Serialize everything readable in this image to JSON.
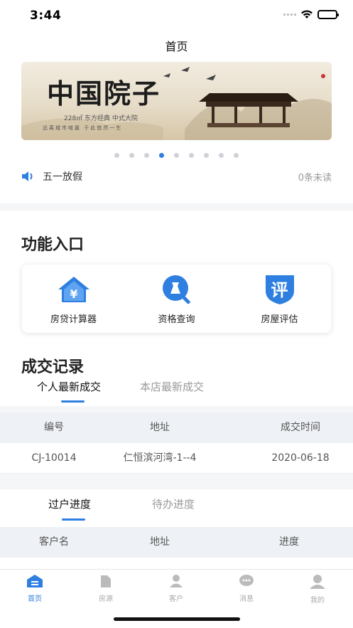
{
  "status_bar": {
    "time": "3:44"
  },
  "nav": {
    "title": "首页"
  },
  "banner": {
    "calligraphy": "中国院子",
    "subtitle": "228㎡ 东方经典 中式大院",
    "tagline": "远离城市喧嚣    于此悠然一生"
  },
  "carousel": {
    "count": 9,
    "active_index": 3
  },
  "notice": {
    "text": "五一放假",
    "unread": "0条未读"
  },
  "functions": {
    "title": "功能入口",
    "items": [
      {
        "label": "房贷计算器",
        "icon": "house-yen-icon"
      },
      {
        "label": "资格查询",
        "icon": "search-qualification-icon"
      },
      {
        "label": "房屋评估",
        "icon": "evaluate-badge-icon",
        "glyph": "评"
      }
    ]
  },
  "deals": {
    "title": "成交记录",
    "tabs": [
      {
        "label": "个人最新成交",
        "active": true
      },
      {
        "label": "本店最新成交",
        "active": false
      }
    ],
    "columns": [
      "编号",
      "地址",
      "成交时间"
    ],
    "rows": [
      {
        "id": "CJ-10014",
        "address": "仁恒滨河湾-1--4",
        "date": "2020-06-18"
      }
    ]
  },
  "progress": {
    "tabs": [
      {
        "label": "过户进度",
        "active": true
      },
      {
        "label": "待办进度",
        "active": false
      }
    ],
    "columns": [
      "客户名",
      "地址",
      "进度"
    ]
  },
  "tabbar": {
    "items": [
      {
        "label": "首页",
        "icon": "home-icon",
        "active": true
      },
      {
        "label": "房源",
        "icon": "listing-icon",
        "active": false
      },
      {
        "label": "客户",
        "icon": "customer-icon",
        "active": false
      },
      {
        "label": "消息",
        "icon": "message-icon",
        "active": false
      },
      {
        "label": "我的",
        "icon": "profile-icon",
        "active": false
      }
    ]
  },
  "colors": {
    "accent": "#2e7fe0",
    "text": "#333333",
    "muted": "#999999",
    "table_head": "#eef1f5"
  }
}
